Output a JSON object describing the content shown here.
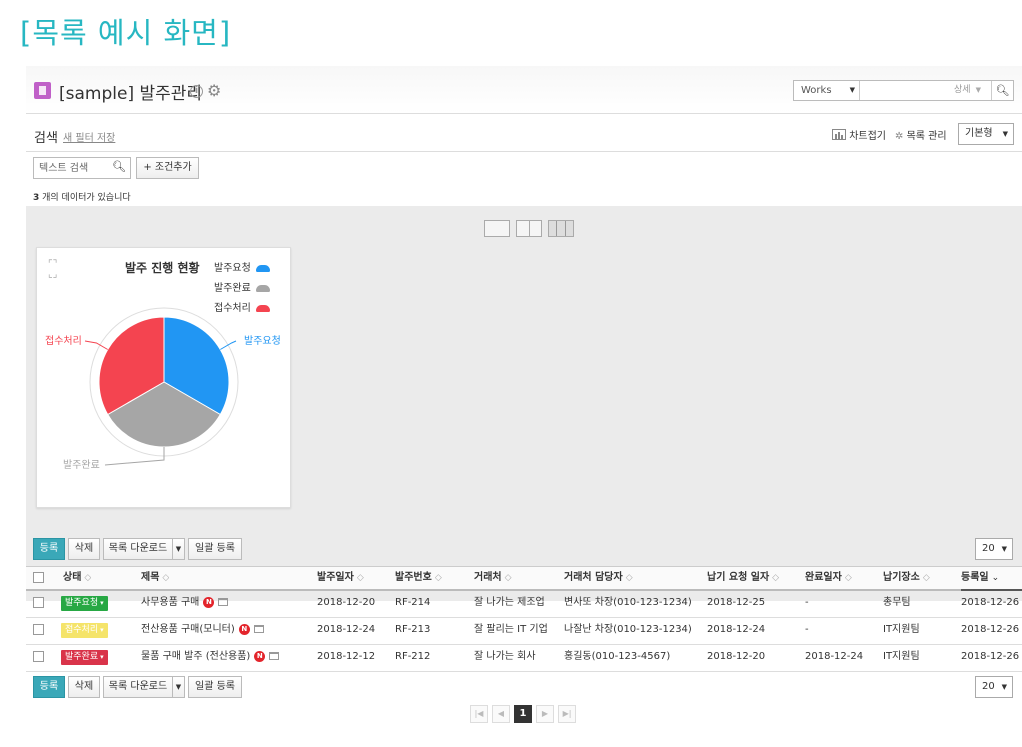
{
  "caption": "[목록 예시 화면]",
  "header": {
    "title": "[sample] 발주관리",
    "works_select": "Works",
    "detail_label": "상세",
    "icons": [
      "app-icon",
      "info-icon",
      "gear-icon",
      "search-icon"
    ]
  },
  "filter": {
    "title": "검색",
    "save_filter": "새 필터 저장",
    "chart_fold": "차트접기",
    "list_manage": "목록 관리",
    "view_select": "기본형",
    "text_search_placeholder": "텍스트 검색",
    "add_condition": "+ 조건추가"
  },
  "count": {
    "number": "3",
    "text": " 개의 데이터가 있습니다"
  },
  "chart_data": {
    "type": "pie",
    "title": "발주 진행 현황",
    "categories": [
      "발주요청",
      "발주완료",
      "접수처리"
    ],
    "values": [
      1,
      1,
      1
    ],
    "colors": [
      "#2196f3",
      "#a6a6a6",
      "#f44450"
    ],
    "slice_labels": [
      "발주요청",
      "발주완료",
      "접수처리"
    ],
    "legend_position": "top-right"
  },
  "toolbar": {
    "register": "등록",
    "delete": "삭제",
    "download": "목록 다운로드",
    "bulk_register": "일괄 등록",
    "page_size": "20"
  },
  "table": {
    "columns": [
      "상태",
      "제목",
      "발주일자",
      "발주번호",
      "거래처",
      "거래처 담당자",
      "납기 요청 일자",
      "완료일자",
      "납기장소",
      "등록일"
    ],
    "rows": [
      {
        "status": "발주요청",
        "status_color": "#27a844",
        "title": "사무용품 구매",
        "badge": "N",
        "order_date": "2018-12-20",
        "order_no": "RF-214",
        "vendor": "잘 나가는 제조업",
        "contact": "변사또 차장(010-123-1234)",
        "due_date": "2018-12-25",
        "done_date": "-",
        "place": "총무팀",
        "reg_date": "2018-12-26"
      },
      {
        "status": "접수처리",
        "status_color": "#f5e46a",
        "title": "전산용품 구매(모니터)",
        "badge": "N",
        "order_date": "2018-12-24",
        "order_no": "RF-213",
        "vendor": "잘 팔리는 IT 기업",
        "contact": "나잘난 차장(010-123-1234)",
        "due_date": "2018-12-24",
        "done_date": "-",
        "place": "IT지원팀",
        "reg_date": "2018-12-26"
      },
      {
        "status": "발주완료",
        "status_color": "#d9344a",
        "title": "물품 구매 발주 (전산용품)",
        "badge": "N",
        "order_date": "2018-12-12",
        "order_no": "RF-212",
        "vendor": "잘 나가는 회사",
        "contact": "홍길동(010-123-4567)",
        "due_date": "2018-12-20",
        "done_date": "2018-12-24",
        "place": "IT지원팀",
        "reg_date": "2018-12-26"
      }
    ]
  },
  "pagination": {
    "current": "1"
  }
}
